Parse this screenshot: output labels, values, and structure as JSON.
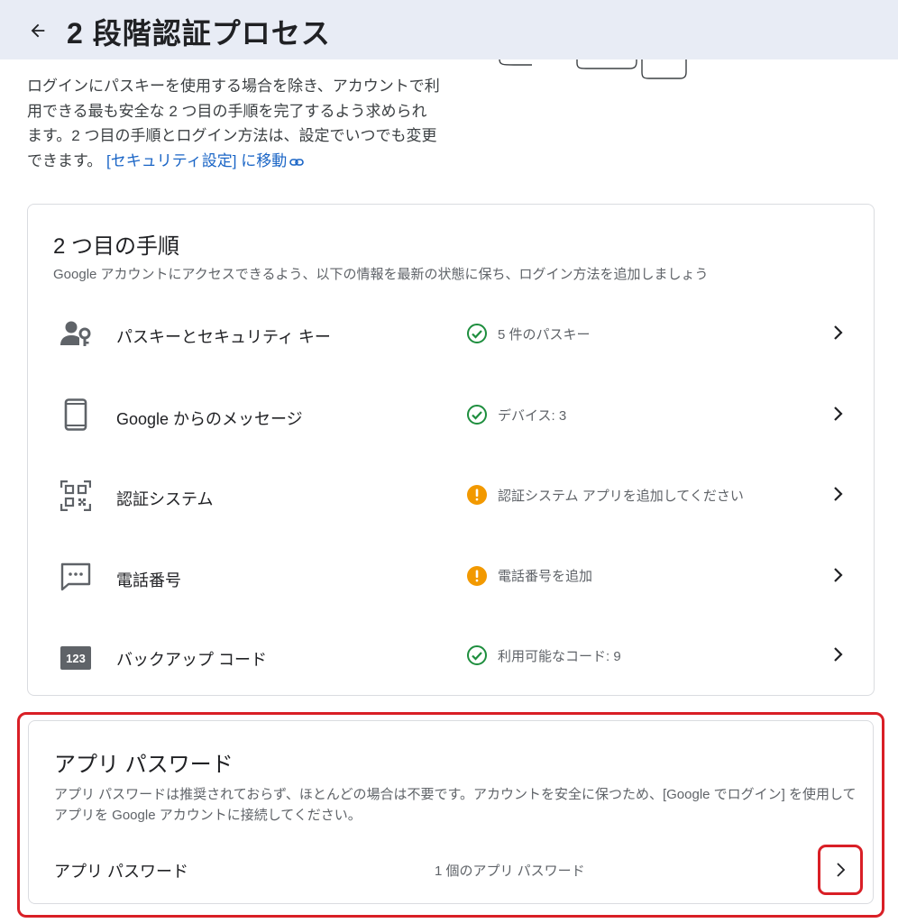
{
  "header": {
    "title": "2 段階認証プロセス"
  },
  "intro": {
    "text": "ログインにパスキーを使用する場合を除き、アカウントで利用できる最も安全な 2 つ目の手順を完了するよう求められます。2 つ目の手順とログイン方法は、設定でいつでも変更できます。",
    "link_label": "[セキュリティ設定] に移動"
  },
  "second_steps": {
    "title": "2 つ目の手順",
    "subtitle": "Google アカウントにアクセスできるよう、以下の情報を最新の状態に保ち、ログイン方法を追加しましょう",
    "items": [
      {
        "label": "パスキーとセキュリティ キー",
        "status": "5 件のパスキー",
        "icon": "passkey-icon",
        "status_type": "ok"
      },
      {
        "label": "Google からのメッセージ",
        "status": "デバイス: 3",
        "icon": "phone-icon",
        "status_type": "ok"
      },
      {
        "label": "認証システム",
        "status": "認証システム アプリを追加してください",
        "icon": "qr-code-icon",
        "status_type": "warning"
      },
      {
        "label": "電話番号",
        "status": "電話番号を追加",
        "icon": "sms-icon",
        "status_type": "warning"
      },
      {
        "label": "バックアップ コード",
        "status": "利用可能なコード: 9",
        "icon": "backup-codes-icon",
        "status_type": "ok",
        "icon_text": "123"
      }
    ]
  },
  "app_passwords": {
    "title": "アプリ パスワード",
    "description": "アプリ パスワードは推奨されておらず、ほとんどの場合は不要です。アカウントを安全に保つため、[Google でログイン] を使用してアプリを Google アカウントに接続してください。",
    "row_label": "アプリ パスワード",
    "row_value": "1 個のアプリ パスワード"
  },
  "colors": {
    "header_bg": "#e8ecf5",
    "ok_green": "#1e8e3e",
    "warning_orange": "#f29900",
    "link_blue": "#1a65c6",
    "highlight_red": "#d91f26"
  }
}
